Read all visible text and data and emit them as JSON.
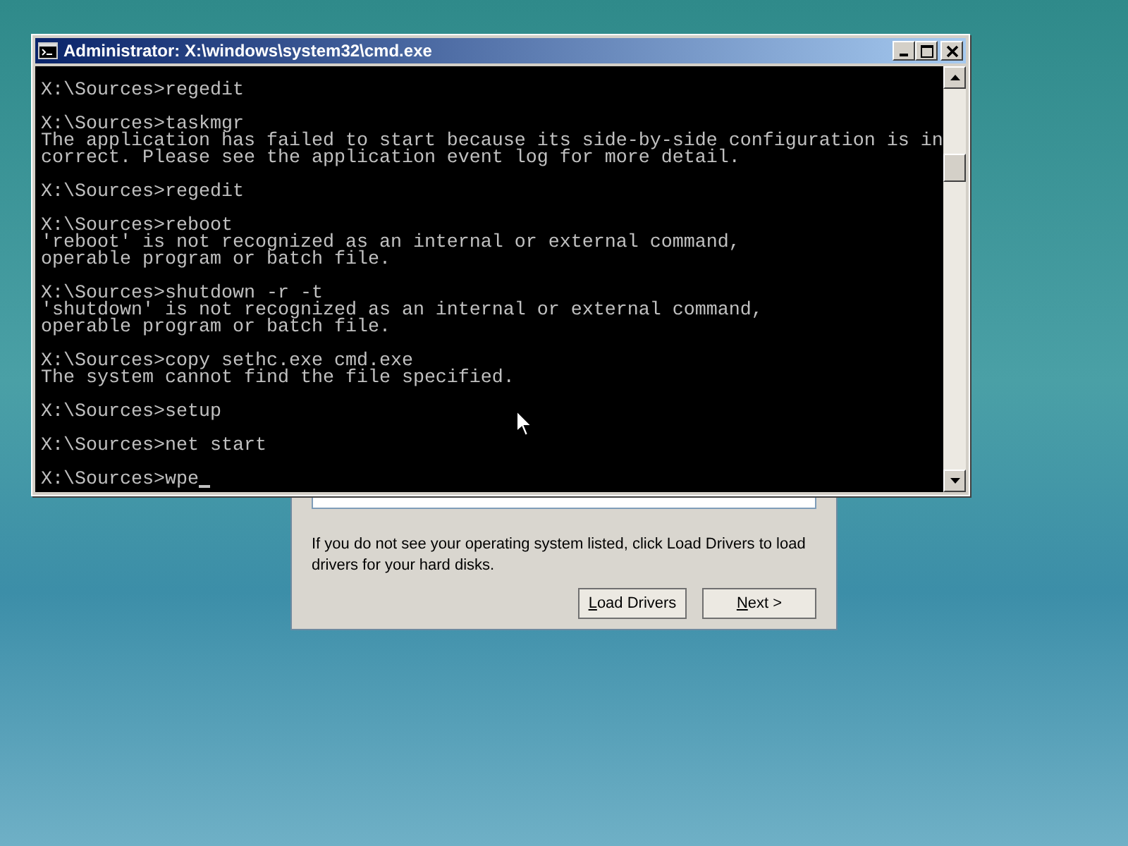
{
  "setup_dialog": {
    "hint": "If you do not see your operating system listed, click Load Drivers to load drivers for your hard disks.",
    "buttons": [
      "Load Drivers",
      "Next >"
    ]
  },
  "console_window": {
    "title": "Administrator: X:\\windows\\system32\\cmd.exe",
    "entries": [
      {
        "lines": [
          "X:\\Sources>regedit"
        ]
      },
      {
        "lines": [
          "X:\\Sources>taskmgr",
          "The application has failed to start because its side-by-side configuration is in",
          "correct. Please see the application event log for more detail."
        ]
      },
      {
        "lines": [
          "X:\\Sources>regedit"
        ]
      },
      {
        "lines": [
          "X:\\Sources>reboot",
          "'reboot' is not recognized as an internal or external command,",
          "operable program or batch file."
        ]
      },
      {
        "lines": [
          "X:\\Sources>shutdown -r -t",
          "'shutdown' is not recognized as an internal or external command,",
          "operable program or batch file."
        ]
      },
      {
        "lines": [
          "X:\\Sources>copy sethc.exe cmd.exe",
          "The system cannot find the file specified."
        ]
      },
      {
        "lines": [
          "X:\\Sources>setup"
        ]
      },
      {
        "lines": [
          "X:\\Sources>net start"
        ]
      }
    ],
    "input": "X:\\Sources>wpe"
  }
}
